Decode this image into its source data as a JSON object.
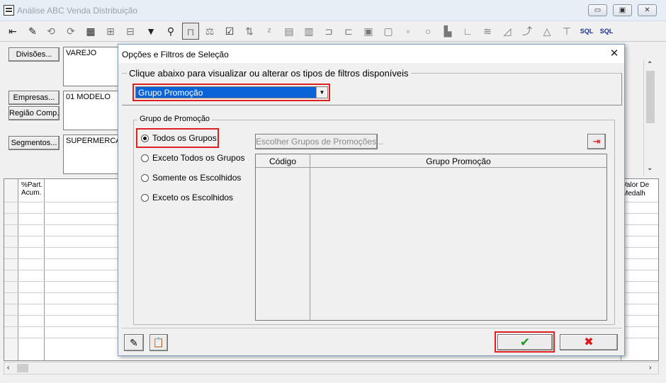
{
  "window": {
    "title": "Análise ABC Venda Distribuição",
    "minimize": "▭",
    "restore": "▣",
    "close": "✕"
  },
  "toolbar": {
    "sql_label": "SQL"
  },
  "filters": {
    "divisoes_label": "Divisões...",
    "divisoes_value": "VAREJO",
    "empresas_label": "Empresas...",
    "empresas_value": "01 MODELO",
    "regiao_label": "Região Comp.",
    "segmentos_label": "Segmentos...",
    "segmentos_value": "SUPERMERCA"
  },
  "grid": {
    "col_part_line1": "%Part.",
    "col_part_line2": "Acum.",
    "col_valor_line1": "Valor De",
    "col_valor_line2": "Medalh"
  },
  "dialog": {
    "title": "Opções e Filtros de Seleção",
    "close_glyph": "✕",
    "section_title": "Clique abaixo para visualizar ou alterar os tipos de filtros disponíveis",
    "filter_type_selected": "Grupo Promoção",
    "group_title": "Grupo de Promoção",
    "radio_options": [
      "Todos os Grupos",
      "Exceto Todos os Grupos",
      "Somente os Escolhidos",
      "Exceto os Escolhidos"
    ],
    "selected_radio": "Todos os Grupos",
    "choose_button": "Escolher Grupos de Promoções...",
    "table_headers": [
      "Código",
      "Grupo Promoção"
    ],
    "ok_glyph": "✔",
    "cancel_glyph": "✖"
  },
  "colors": {
    "highlight_red": "#e02020",
    "select_blue": "#0a64d8",
    "ok_green": "#1f9a1f",
    "cancel_red": "#d81818"
  }
}
